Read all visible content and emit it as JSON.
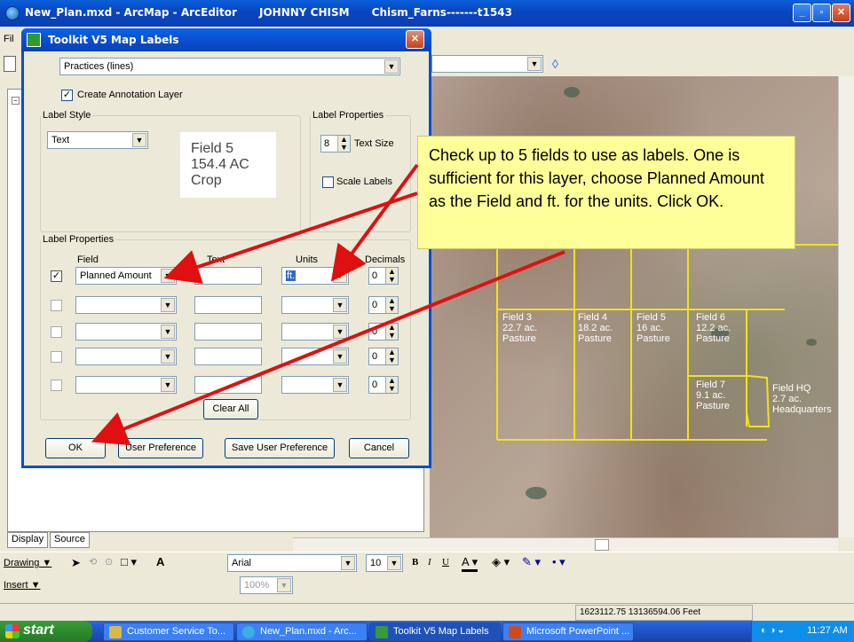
{
  "window": {
    "title": "New_Plan.mxd - ArcMap - ArcEditor      JOHNNY CHISM      Chism_Farns-------t1543",
    "buttons": [
      "_",
      "▫",
      "✕"
    ]
  },
  "menu": {
    "first": "Fil",
    "partial": "D"
  },
  "dialog": {
    "title": "Toolkit V5 Map Labels",
    "layer_select": "Practices (lines)",
    "create_annotation": "Create Annotation Layer",
    "label_style_legend": "Label Style",
    "label_style_value": "Text",
    "preview_lines": [
      "Field 5",
      "154.4 AC",
      "Crop"
    ],
    "label_props_top_legend": "Label Properties",
    "text_size_value": "8",
    "text_size_label": "Text Size",
    "scale_labels": "Scale Labels",
    "label_props_legend": "Label Properties",
    "col_field": "Field",
    "col_text": "Text",
    "col_units": "Units",
    "col_decimals": "Decimals",
    "rows": [
      {
        "checked": true,
        "field": "Planned Amount",
        "text": "",
        "units": "ft.",
        "decimals": "0"
      },
      {
        "checked": false,
        "field": "",
        "text": "",
        "units": "",
        "decimals": "0"
      },
      {
        "checked": false,
        "field": "",
        "text": "",
        "units": "",
        "decimals": "0"
      },
      {
        "checked": false,
        "field": "",
        "text": "",
        "units": "",
        "decimals": "0"
      },
      {
        "checked": false,
        "field": "",
        "text": "",
        "units": "",
        "decimals": "0"
      }
    ],
    "clear_all": "Clear All",
    "ok": "OK",
    "user_preference": "User Preference",
    "save_user_preference": "Save User Preference",
    "cancel": "Cancel"
  },
  "callout": "Check up to 5 fields to use as labels. One is sufficient for this layer, choose Planned Amount as the Field and ft. for the units. Click OK.",
  "map_labels": [
    "Field 3\n22.7 ac.\nPasture",
    "Field 4\n18.2 ac.\nPasture",
    "Field 5\n16 ac.\nPasture",
    "Field 6\n12.2 ac.\nPasture",
    "Field 7\n9.1 ac.\nPasture",
    "Field HQ\n2.7 ac.\nHeadquarters"
  ],
  "toc_tabs": [
    "Display",
    "Source"
  ],
  "drawbar": {
    "drawing": "Drawing ▼",
    "font": "Arial",
    "size": "10",
    "bold": "B",
    "italic": "I",
    "underline": "U",
    "text_tool": "A"
  },
  "insertbar": {
    "insert": "Insert ▼",
    "zoom": "100%"
  },
  "status": {
    "coords": "1623112.75  13136594.06 Feet"
  },
  "taskbar": {
    "start": "start",
    "items": [
      "Customer Service To...",
      "New_Plan.mxd - Arc...",
      "Toolkit V5 Map Labels",
      "Microsoft PowerPoint ..."
    ],
    "clock": "11:27 AM"
  }
}
